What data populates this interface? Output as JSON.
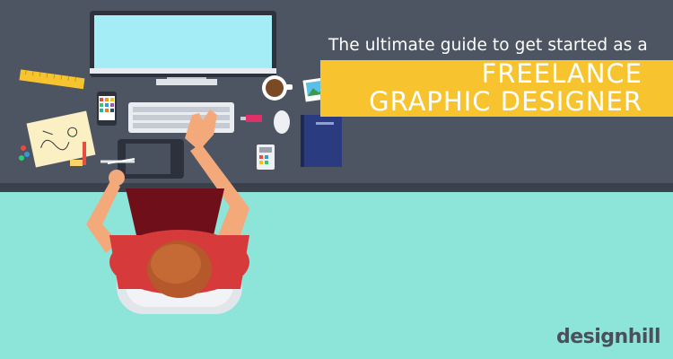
{
  "headline": {
    "subtitle": "The ultimate guide to get started as a",
    "line1": "FREELANCE",
    "line2": "GRAPHIC DESIGNER"
  },
  "brand": {
    "name": "designhill"
  },
  "icons": [
    "imac-monitor",
    "keyboard",
    "mouse",
    "phone-palette",
    "coffee-cup",
    "photo-frame",
    "notebook",
    "calculator",
    "drawing-tablet",
    "stylus-pen",
    "sketch-paper",
    "ruler",
    "usb-drive",
    "paper-clips",
    "chair",
    "designer-person"
  ],
  "colors": {
    "desk": "#4d5563",
    "floor": "#8de4d8",
    "banner": "#f7c42f",
    "shirt": "#d63a3a",
    "skin": "#f4a97b",
    "hair": "#b5582b",
    "screen": "#a4ecf6",
    "notebook": "#2a3b7f"
  }
}
